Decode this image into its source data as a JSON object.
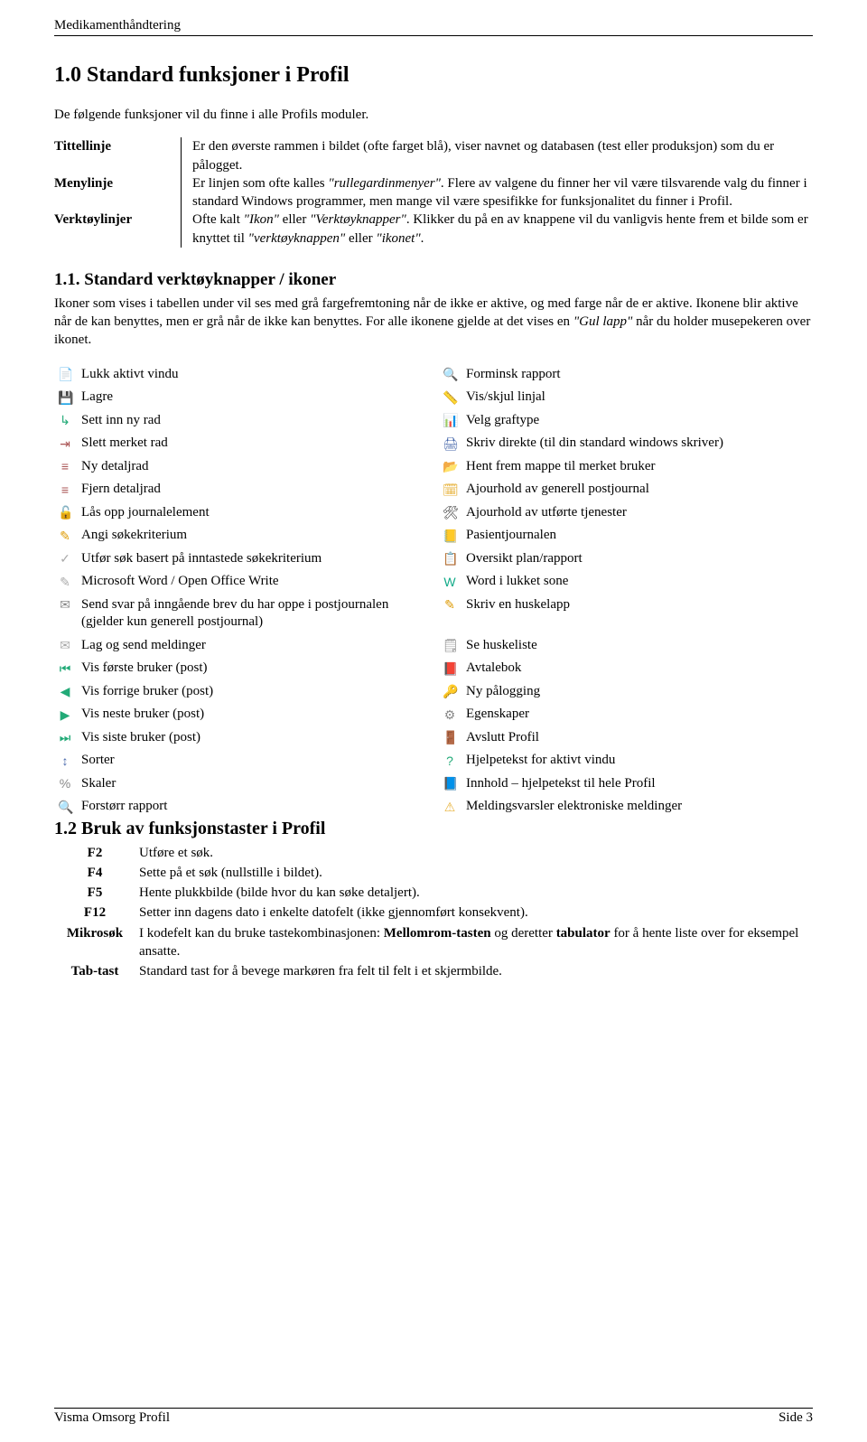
{
  "header": {
    "title": "Medikamenthåndtering"
  },
  "h1": "1.0 Standard funksjoner i Profil",
  "intro": "De følgende funksjoner vil du finne i alle Profils moduler.",
  "defs": {
    "rows": [
      {
        "term": "Tittellinje",
        "desc": "Er den øverste rammen i bildet (ofte farget blå), viser navnet og databasen (test eller produksjon) som du er pålogget."
      },
      {
        "term": "Menylinje",
        "desc_pre": "Er linjen som ofte kalles ",
        "desc_em": "\"rullegardinmenyer\"",
        "desc_post": ". Flere av valgene du finner her vil være tilsvarende valg du finner i standard Windows programmer, men mange vil være spesifikke for funksjonalitet du finner i Profil."
      },
      {
        "term": "Verktøylinjer",
        "desc_pre": "Ofte kalt ",
        "desc_em": "\"Ikon\"",
        "desc_mid": " eller ",
        "desc_em2": "\"Verktøyknapper\"",
        "desc_post_pre": ". Klikker du på en av knappene vil du vanligvis hente frem et bilde som er knyttet til ",
        "desc_em3": "\"verktøyknappen\"",
        "desc_post_mid": " eller ",
        "desc_em4": "\"ikonet\"",
        "desc_post_end": "."
      }
    ]
  },
  "h2": "1.1. Standard verktøyknapper / ikoner",
  "para11_pre": "Ikoner som vises i tabellen under vil ses med grå fargefremtoning når de ikke er aktive, og med farge når de er aktive. Ikonene blir aktive når de kan benyttes, men er grå når de ikke kan benyttes. For alle ikonene gjelde at det vises en ",
  "para11_em": "\"Gul lapp\"",
  "para11_post": " når du holder musepekeren over ikonet.",
  "iconRows": [
    {
      "l": "Lukk aktivt vindu",
      "li": "close-window-icon",
      "lg": "📄",
      "lc": "#888",
      "r": "Forminsk rapport",
      "ri": "zoom-out-icon",
      "rg": "🔍",
      "rc": "#888"
    },
    {
      "l": "Lagre",
      "li": "save-icon",
      "lg": "💾",
      "lc": "#888",
      "r": "Vis/skjul linjal",
      "ri": "ruler-icon",
      "rg": "📏",
      "rc": "#888"
    },
    {
      "l": "Sett inn ny rad",
      "li": "insert-row-icon",
      "lg": "↳",
      "lc": "#2a7",
      "r": "Velg graftype",
      "ri": "chart-type-icon",
      "rg": "📊",
      "rc": "#888"
    },
    {
      "l": "Slett merket rad",
      "li": "delete-row-icon",
      "lg": "⇥",
      "lc": "#a55",
      "r": "Skriv direkte (til din standard windows skriver)",
      "ri": "print-direct-icon",
      "rg": "🖨",
      "rc": "#46a"
    },
    {
      "l": "Ny detaljrad",
      "li": "new-detail-row-icon",
      "lg": "≡",
      "lc": "#a55",
      "r": "Hent frem mappe til merket bruker",
      "ri": "open-folder-icon",
      "rg": "📂",
      "rc": "#E7B23A"
    },
    {
      "l": "Fjern detaljrad",
      "li": "remove-detail-row-icon",
      "lg": "≡",
      "lc": "#a55",
      "r": "Ajourhold av generell postjournal",
      "ri": "update-journal-icon",
      "rg": "🗓",
      "rc": "#E7B23A"
    },
    {
      "l": "Lås opp journalelement",
      "li": "unlock-icon",
      "lg": "🔓",
      "lc": "#aaa",
      "r": "Ajourhold av utførte tjenester",
      "ri": "tools-icon",
      "rg": "🛠",
      "rc": "#333"
    },
    {
      "l": "Angi søkekriterium",
      "li": "search-criteria-icon",
      "lg": "✎",
      "lc": "#d90",
      "r": "Pasientjournalen",
      "ri": "patient-journal-icon",
      "rg": "📒",
      "rc": "#E7B23A"
    },
    {
      "l": "Utfør søk basert på inntastede søkekriterium",
      "li": "execute-search-icon",
      "lg": "✓",
      "lc": "#aaa",
      "r": "Oversikt plan/rapport",
      "ri": "clipboard-icon",
      "rg": "📋",
      "rc": "#46a"
    },
    {
      "l": "Microsoft Word / Open Office Write",
      "li": "word-icon",
      "lg": "✎",
      "lc": "#aaa",
      "r": "Word i lukket sone",
      "ri": "word-locked-icon",
      "rg": "W",
      "rc": "#1a8"
    },
    {
      "l": "Send svar på inngående brev du har oppe i postjournalen (gjelder kun generell postjournal)",
      "li": "send-reply-icon",
      "lg": "✉",
      "lc": "#888",
      "r": "Skriv en huskelapp",
      "ri": "note-write-icon",
      "rg": "✎",
      "lc2": "",
      "rc": "#d90"
    },
    {
      "l": "Lag og send meldinger",
      "li": "compose-message-icon",
      "lg": "✉",
      "lc": "#aaa",
      "r": "Se huskeliste",
      "ri": "note-list-icon",
      "rg": "🗒",
      "rc": "#888"
    },
    {
      "l": "Vis første bruker (post)",
      "li": "first-user-icon",
      "lg": "⏮",
      "lc": "#2a7",
      "r": "Avtalebok",
      "ri": "appointment-book-icon",
      "rg": "📕",
      "rc": "#888"
    },
    {
      "l": "Vis forrige bruker (post)",
      "li": "prev-user-icon",
      "lg": "◀",
      "lc": "#2a7",
      "r": "Ny pålogging",
      "ri": "new-login-icon",
      "rg": "🔑",
      "rc": "#46a"
    },
    {
      "l": "Vis neste bruker (post)",
      "li": "next-user-icon",
      "lg": "▶",
      "lc": "#2a7",
      "r": "Egenskaper",
      "ri": "properties-icon",
      "rg": "⚙",
      "rc": "#888"
    },
    {
      "l": "Vis siste bruker (post)",
      "li": "last-user-icon",
      "lg": "⏭",
      "lc": "#2a7",
      "r": "Avslutt Profil",
      "ri": "exit-icon",
      "rg": "🚪",
      "rc": "#b55"
    },
    {
      "l": "Sorter",
      "li": "sort-icon",
      "lg": "↕",
      "lc": "#46a",
      "r": "Hjelpetekst for aktivt vindu",
      "ri": "help-context-icon",
      "rg": "?",
      "rc": "#2a7"
    },
    {
      "l": "Skaler",
      "li": "scale-icon",
      "lg": "%",
      "lc": "#888",
      "r": "Innhold – hjelpetekst til hele Profil",
      "ri": "help-contents-icon",
      "rg": "📘",
      "rc": "#46a"
    },
    {
      "l": "Forstørr rapport",
      "li": "zoom-in-icon",
      "lg": "🔍",
      "lc": "#888",
      "r": "Meldingsvarsler elektroniske meldinger",
      "ri": "alert-icon",
      "rg": "⚠",
      "rc": "#E7B23A"
    }
  ],
  "h3": "1.2 Bruk av funksjonstaster i Profil",
  "fkeys": [
    {
      "key": "F2",
      "desc": "Utføre et søk."
    },
    {
      "key": "F4",
      "desc": "Sette på et søk (nullstille i bildet)."
    },
    {
      "key": "F5",
      "desc": "Hente plukkbilde (bilde hvor du kan søke detaljert)."
    },
    {
      "key": "F12",
      "desc": "Setter inn dagens dato i enkelte datofelt (ikke gjennomført konsekvent)."
    },
    {
      "key": "Mikrosøk",
      "desc_pre": "I kodefelt kan du bruke tastekombinasjonen: ",
      "desc_bold": "Mellomrom-tasten",
      "desc_mid": " og deretter ",
      "desc_bold2": "tabulator",
      "desc_post": " for å hente liste over for eksempel ansatte."
    },
    {
      "key": "Tab-tast",
      "desc": "Standard tast for å bevege markøren fra felt til felt i et skjermbilde."
    }
  ],
  "footer": {
    "left": "Visma Omsorg Profil",
    "right": "Side 3"
  }
}
